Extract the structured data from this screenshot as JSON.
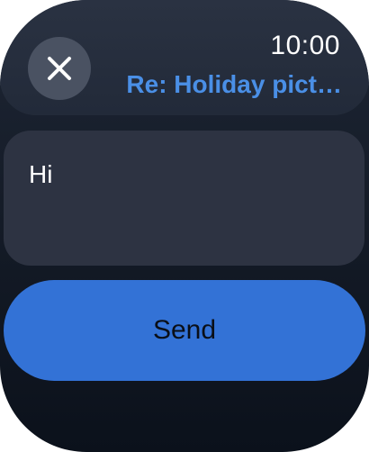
{
  "status": {
    "time": "10:00"
  },
  "header": {
    "subject": "Re: Holiday pict…",
    "close_icon": "close-icon"
  },
  "compose": {
    "message": "Hi"
  },
  "actions": {
    "send_label": "Send"
  },
  "colors": {
    "accent": "#3372d6",
    "subject_text": "#4a8fe6",
    "background": "#151c28",
    "field": "#2d3342"
  }
}
